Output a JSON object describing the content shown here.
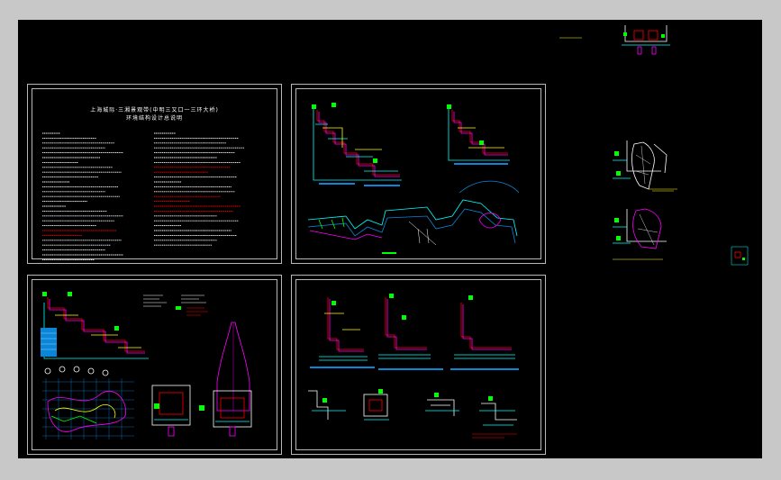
{
  "drawing": {
    "title_line_1": "上海城际·三湘景观带(中明三又口一三环大桥)",
    "title_line_2": "环境结构设计总说明"
  },
  "colors": {
    "background": "#000000",
    "frame": "#c8c8c8",
    "sheet_border": "#b8b8b8",
    "cyan": "#00ffff",
    "green": "#00ff00",
    "red": "#ff0000",
    "magenta": "#ff00ff",
    "yellow": "#ffff00",
    "blue": "#0a86d8",
    "white": "#ffffff"
  },
  "sheets": [
    {
      "name": "design-notes-sheet",
      "icon": "text-notes-icon"
    },
    {
      "name": "section-details-sheet",
      "icon": "cad-section-icon"
    },
    {
      "name": "plan-and-details-sheet",
      "icon": "cad-plan-icon"
    },
    {
      "name": "wall-sections-sheet",
      "icon": "cad-section-icon"
    }
  ]
}
